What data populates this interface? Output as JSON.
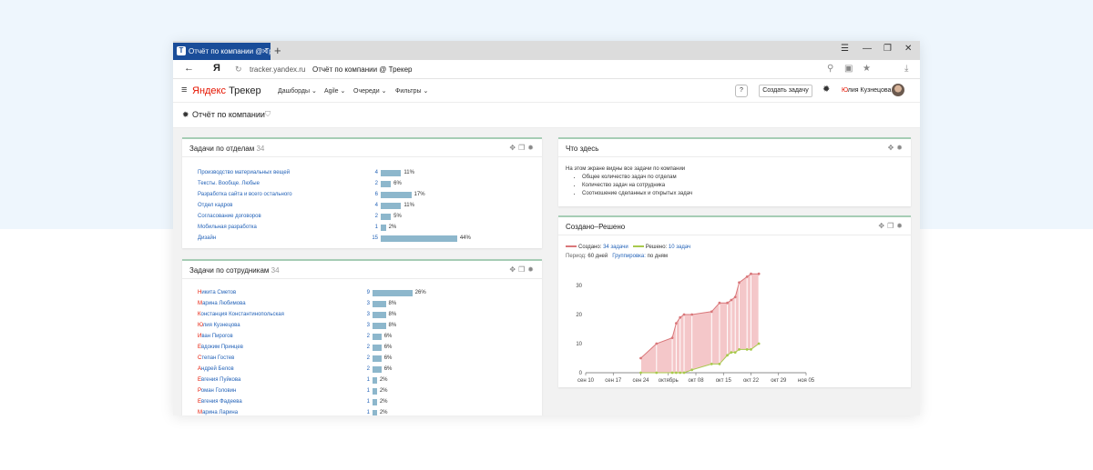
{
  "browser": {
    "tab_title": "Отчёт по компании @ Тр",
    "tab_icon": "Т",
    "url": "tracker.yandex.ru",
    "page_title": "Отчёт по компании @ Трекер",
    "yandex_button": "Я"
  },
  "app": {
    "logo_brand": "Яндекс",
    "logo_product": "Трекер",
    "nav": [
      "Дашборды",
      "Agile",
      "Очереди",
      "Фильтры"
    ],
    "help_label": "?",
    "create_task_label": "Создать задачу",
    "user_first_letter": "Ю",
    "user_name_rest": "лия Кузнецова"
  },
  "page": {
    "title": "Отчёт по компании"
  },
  "departments_widget": {
    "title": "Задачи по отделам",
    "count": "34",
    "rows": [
      {
        "name": "Производство материальных вещей",
        "count": 4,
        "pct": "11%"
      },
      {
        "name": "Тексты. Вообще. Любые",
        "count": 2,
        "pct": "6%"
      },
      {
        "name": "Разработка сайта и всего остального",
        "count": 6,
        "pct": "17%"
      },
      {
        "name": "Отдел кадров",
        "count": 4,
        "pct": "11%"
      },
      {
        "name": "Согласование договоров",
        "count": 2,
        "pct": "5%"
      },
      {
        "name": "Мобильная разработка",
        "count": 1,
        "pct": "2%"
      },
      {
        "name": "Дизайн",
        "count": 15,
        "pct": "44%"
      }
    ]
  },
  "employees_widget": {
    "title": "Задачи по сотрудникам",
    "count": "34",
    "rows": [
      {
        "first": "Н",
        "rest": "икита Сметов",
        "count": 9,
        "pct": "26%"
      },
      {
        "first": "М",
        "rest": "арина Любимова",
        "count": 3,
        "pct": "8%"
      },
      {
        "first": "К",
        "rest": "онстанция Константинопольская",
        "count": 3,
        "pct": "8%"
      },
      {
        "first": "Ю",
        "rest": "лия Кузнецова",
        "count": 3,
        "pct": "8%"
      },
      {
        "first": "И",
        "rest": "ван Пирогов",
        "count": 2,
        "pct": "6%"
      },
      {
        "first": "Е",
        "rest": "вдоким Принцев",
        "count": 2,
        "pct": "6%"
      },
      {
        "first": "С",
        "rest": "тепан Гостев",
        "count": 2,
        "pct": "6%"
      },
      {
        "first": "А",
        "rest": "ндрей Белов",
        "count": 2,
        "pct": "6%"
      },
      {
        "first": "Е",
        "rest": "вгения Пуйкова",
        "count": 1,
        "pct": "2%"
      },
      {
        "first": "Р",
        "rest": "оман Головин",
        "count": 1,
        "pct": "2%"
      },
      {
        "first": "Е",
        "rest": "вгения Фадеева",
        "count": 1,
        "pct": "2%"
      },
      {
        "first": "М",
        "rest": "арина Ларина",
        "count": 1,
        "pct": "2%"
      }
    ]
  },
  "info_widget": {
    "title": "Что здесь",
    "text": "На этом экране видны все задачи по компании",
    "items": [
      "Общее количество задач по отделам",
      "Количество задач на сотрудника",
      "Соотношение сделанных и открытых задач"
    ]
  },
  "created_resolved_widget": {
    "title": "Создано–Решено",
    "legend": {
      "created_label": "Создано:",
      "created_value": "34 задачи",
      "resolved_label": "Решено:",
      "resolved_value": "10 задач"
    },
    "period_label": "Период:",
    "period_value": "60 дней",
    "grouping_label": "Группировка:",
    "grouping_value": "по дням"
  },
  "colors": {
    "accent_blue": "#2463b8",
    "tab_blue": "#1a4d99",
    "bar": "#8db7cc",
    "created": "#d9777a",
    "resolved": "#a8c94c",
    "fill_area": "#f4c7c9",
    "widget_top": "#a6cdb5"
  },
  "chart_data": {
    "type": "area",
    "series": [
      {
        "name": "Создано",
        "x": [
          0,
          4,
          8,
          9,
          10,
          11,
          13,
          18,
          20,
          22,
          23,
          24,
          25,
          27,
          28,
          30
        ],
        "values": [
          5,
          10,
          12,
          17,
          19,
          20,
          20,
          21,
          24,
          24,
          25,
          26,
          31,
          33,
          34,
          34
        ]
      },
      {
        "name": "Решено",
        "x": [
          0,
          4,
          8,
          9,
          10,
          11,
          13,
          18,
          20,
          22,
          23,
          24,
          25,
          27,
          28,
          30
        ],
        "values": [
          0,
          0,
          0,
          0,
          0,
          0,
          1,
          3,
          3,
          6,
          7,
          7,
          8,
          8,
          8,
          10
        ]
      }
    ],
    "x_ticks": [
      "сен 10",
      "сен 17",
      "сен 24",
      "октябрь",
      "окт 08",
      "окт 15",
      "окт 22",
      "окт 29",
      "ноя 05"
    ],
    "y_ticks": [
      0,
      10,
      20,
      30
    ],
    "ylim": [
      0,
      35
    ],
    "grid": false,
    "legend": "top-left"
  }
}
